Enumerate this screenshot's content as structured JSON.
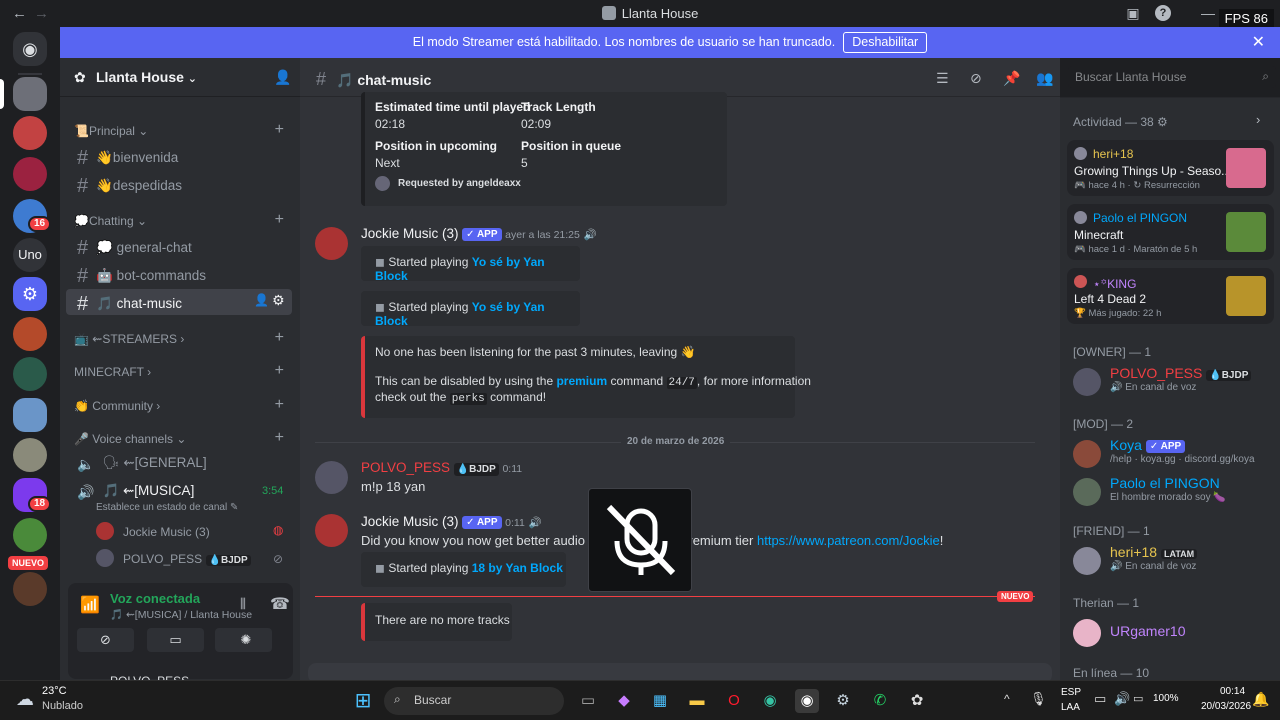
{
  "window": {
    "title": "Llanta House",
    "fps": "FPS 86"
  },
  "banner": {
    "text": "El modo Streamer está habilitado. Los nombres de usuario se han truncado.",
    "button": "Deshabilitar"
  },
  "servers": {
    "badge1": "16",
    "uno": "Uno",
    "badge2": "18",
    "nuevo": "NUEVO"
  },
  "guild": {
    "name": "Llanta House"
  },
  "sidebar": {
    "cat_principal": "📜Principal",
    "ch_bienvenida": "👋bienvenida",
    "ch_despedidas": "👋despedidas",
    "cat_chatting": "💭Chatting",
    "ch_general": "💭 general-chat",
    "ch_bot": "🤖 bot-commands",
    "ch_music": "🎵 chat-music",
    "cat_streamers": "📺 ⇜STREAMERS",
    "cat_minecraft": "MINECRAFT",
    "cat_community": "👏 Community",
    "cat_voice": "🎤 Voice channels",
    "vc_general": "🗣 ⇜[GENERAL]",
    "vc_musica": "🎵 ⇜[MUSICA]",
    "vc_time": "3:54",
    "vc_status": "Establece un estado de canal",
    "vc_user1": "Jockie Music (3)",
    "vc_user2": "POLVO_PESS",
    "vc_user2_tag": "BJDP"
  },
  "voice": {
    "status": "Voz conectada",
    "channel": "🎵 ⇜[MUSICA] / Llanta House",
    "bottom_user": "POLVO_PESS"
  },
  "chat": {
    "channel": "🎵 chat-music",
    "search_placeholder": "Buscar Llanta House",
    "embed1": {
      "l1": "Estimated time until played",
      "v1": "02:18",
      "l2": "Track Length",
      "v2": "02:09",
      "l3": "Position in upcoming",
      "v3": "Next",
      "l4": "Position in queue",
      "v4": "5",
      "req": "Requested by angeldeaxx"
    },
    "msg1": {
      "user": "Jockie Music (3)",
      "tag": "✓ APP",
      "time": "ayer a las 21:25",
      "e1_pre": "Started playing ",
      "e1_link": "Yo sé by Yan Block",
      "e2_pre": "Started playing ",
      "e2_link": "Yo sé by Yan Block",
      "e3_line1": "No one has been listening for the past 3 minutes, leaving 👋",
      "e3_pre": "This can be disabled by using the ",
      "e3_link": "premium",
      "e3_mid": " command ",
      "e3_code": "24/7",
      "e3_post": ", for more information",
      "e3_line3_pre": "check out the ",
      "e3_code2": "perks",
      "e3_line3_post": " command!"
    },
    "divider": "20 de marzo de 2026",
    "msg2": {
      "user": "POLVO_PESS",
      "tag": "BJDP",
      "time": "0:11",
      "text": "m!p 18 yan"
    },
    "msg3": {
      "user": "Jockie Music (3)",
      "tag": "✓ APP",
      "time": "0:11",
      "text_pre": "Did you know you now get better audio quality with any premium tier ",
      "link": "https://www.patreon.com/Jockie",
      "text_post": "!",
      "e_pre": "Started playing ",
      "e_link": "18 by Yan Block"
    },
    "new_label": "NUEVO",
    "msg4": {
      "text": "There are no more tracks"
    }
  },
  "members": {
    "activity_title": "Actividad — 38",
    "act1": {
      "user": "heri+18",
      "game": "Growing Things Up - Seaso...",
      "meta": "hace 4 h",
      "meta2": "Resurrección"
    },
    "act2": {
      "user": "Paolo el PINGON",
      "game": "Minecraft",
      "meta": "hace 1 d",
      "meta2": "Maratón de 5 h"
    },
    "act3": {
      "user": "⋆꙳KING",
      "game": "Left 4 Dead 2",
      "meta": "Más jugado: 22 h"
    },
    "owner": "[OWNER] — 1",
    "owner1": {
      "name": "POLVO_PESS",
      "tag": "BJDP",
      "status": "En canal de voz"
    },
    "mod": "[MOD] — 2",
    "mod1": {
      "name": "Koya",
      "tag": "✓ APP",
      "status": "/help · koya.gg · discord.gg/koya"
    },
    "mod2": {
      "name": "Paolo el PINGON",
      "status": "El hombre morado soy 🍆"
    },
    "friend": "[FRIEND] — 1",
    "friend1": {
      "name": "heri+18",
      "tag": "LATAM",
      "status": "En canal de voz"
    },
    "therian": "Therian — 1",
    "therian1": {
      "name": "URgamer10"
    },
    "online": "En línea — 10"
  },
  "taskbar": {
    "temp": "23°C",
    "weather": "Nublado",
    "search": "Buscar",
    "lang1": "ESP",
    "lang2": "LAA",
    "battery": "100%",
    "time": "00:14",
    "date": "20/03/2026"
  },
  "colors": {
    "blurple": "#5865f2",
    "red": "#f23f43",
    "link": "#00a8fc",
    "green": "#23a55a"
  }
}
